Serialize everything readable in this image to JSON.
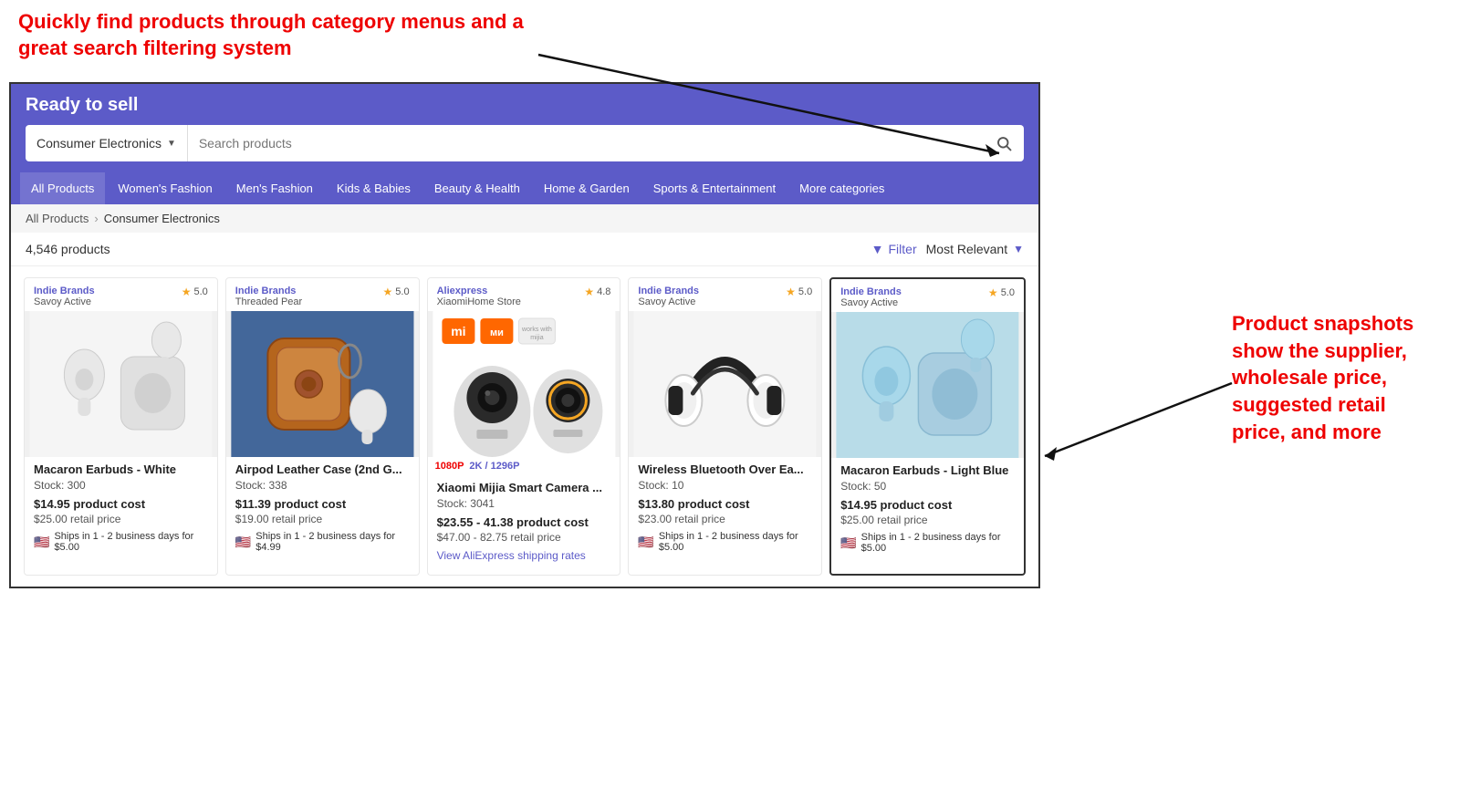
{
  "annotations": {
    "top_text": "Quickly find products through category menus and a great search filtering system",
    "right_text": "Product snapshots show the supplier, wholesale price, suggested retail price, and more"
  },
  "header": {
    "title": "Ready to sell",
    "category_label": "Consumer Electronics",
    "search_placeholder": "Search products"
  },
  "nav": {
    "items": [
      "All Products",
      "Women's Fashion",
      "Men's Fashion",
      "Kids & Babies",
      "Beauty & Health",
      "Home & Garden",
      "Sports & Entertainment",
      "More categories"
    ]
  },
  "breadcrumb": {
    "root": "All Products",
    "current": "Consumer Electronics"
  },
  "filter_bar": {
    "count": "4,546 products",
    "filter_label": "Filter",
    "sort_label": "Most Relevant"
  },
  "products": [
    {
      "id": 1,
      "supplier": "Indie Brands",
      "store": "Savoy Active",
      "rating": "5.0",
      "title": "Macaron Earbuds - White",
      "stock": "Stock: 300",
      "cost": "$14.95 product cost",
      "retail": "$25.00 retail price",
      "shipping": "Ships in 1 - 2 business days for $5.00",
      "image_type": "earbuds_white",
      "highlighted": false
    },
    {
      "id": 2,
      "supplier": "Indie Brands",
      "store": "Threaded Pear",
      "rating": "5.0",
      "title": "Airpod Leather Case (2nd G...",
      "stock": "Stock: 338",
      "cost": "$11.39 product cost",
      "retail": "$19.00 retail price",
      "shipping": "Ships in 1 - 2 business days for $4.99",
      "image_type": "leather_case",
      "highlighted": false
    },
    {
      "id": 3,
      "supplier": "Aliexpress",
      "store": "XiaomiHome Store",
      "rating": "4.8",
      "title": "Xiaomi Mijia Smart Camera ...",
      "stock": "Stock: 3041",
      "cost": "$23.55 - 41.38 product cost",
      "retail": "$47.00 - 82.75 retail price",
      "shipping_aliexpress": "View AliExpress shipping rates",
      "badge1": "1080P",
      "badge2": "2K / 1296P",
      "image_type": "camera",
      "highlighted": false
    },
    {
      "id": 4,
      "supplier": "Indie Brands",
      "store": "Savoy Active",
      "rating": "5.0",
      "title": "Wireless Bluetooth Over Ea...",
      "stock": "Stock: 10",
      "cost": "$13.80 product cost",
      "retail": "$23.00 retail price",
      "shipping": "Ships in 1 - 2 business days for $5.00",
      "image_type": "headphones",
      "highlighted": false
    },
    {
      "id": 5,
      "supplier": "Indie Brands",
      "store": "Savoy Active",
      "rating": "5.0",
      "title": "Macaron Earbuds - Light Blue",
      "stock": "Stock: 50",
      "cost": "$14.95 product cost",
      "retail": "$25.00 retail price",
      "shipping": "Ships in 1 - 2 business days for $5.00",
      "image_type": "earbuds_blue",
      "highlighted": true
    }
  ]
}
